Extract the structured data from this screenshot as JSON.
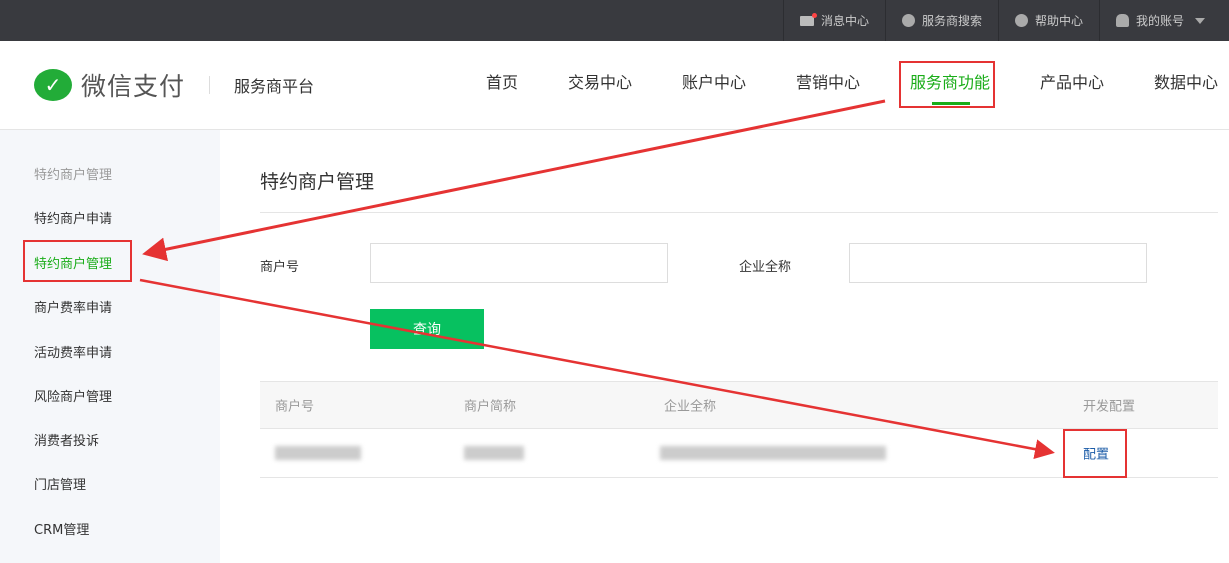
{
  "topbar": {
    "items": [
      {
        "label": "消息中心",
        "icon": "mail-icon"
      },
      {
        "label": "服务商搜索",
        "icon": "search-icon"
      },
      {
        "label": "帮助中心",
        "icon": "help-icon"
      },
      {
        "label": "我的账号",
        "icon": "user-icon"
      }
    ]
  },
  "header": {
    "brand": "微信支付",
    "platform": "服务商平台",
    "nav": [
      "首页",
      "交易中心",
      "账户中心",
      "营销中心",
      "服务商功能",
      "产品中心",
      "数据中心"
    ],
    "active_nav": "服务商功能"
  },
  "sidebar": {
    "group": "特约商户管理",
    "items": [
      "特约商户申请",
      "特约商户管理",
      "商户费率申请",
      "活动费率申请",
      "风险商户管理",
      "消费者投诉",
      "门店管理",
      "CRM管理"
    ],
    "active": "特约商户管理"
  },
  "main": {
    "title": "特约商户管理",
    "form": {
      "merchant_id_label": "商户号",
      "merchant_id_value": "",
      "company_label": "企业全称",
      "company_value": "",
      "query_button": "查询"
    },
    "table": {
      "headers": [
        "商户号",
        "商户简称",
        "企业全称",
        "开发配置"
      ],
      "rows": [
        {
          "action": "配置"
        }
      ]
    }
  },
  "colors": {
    "accent": "#1aad19",
    "button": "#07c160",
    "annotation": "#e53333"
  }
}
